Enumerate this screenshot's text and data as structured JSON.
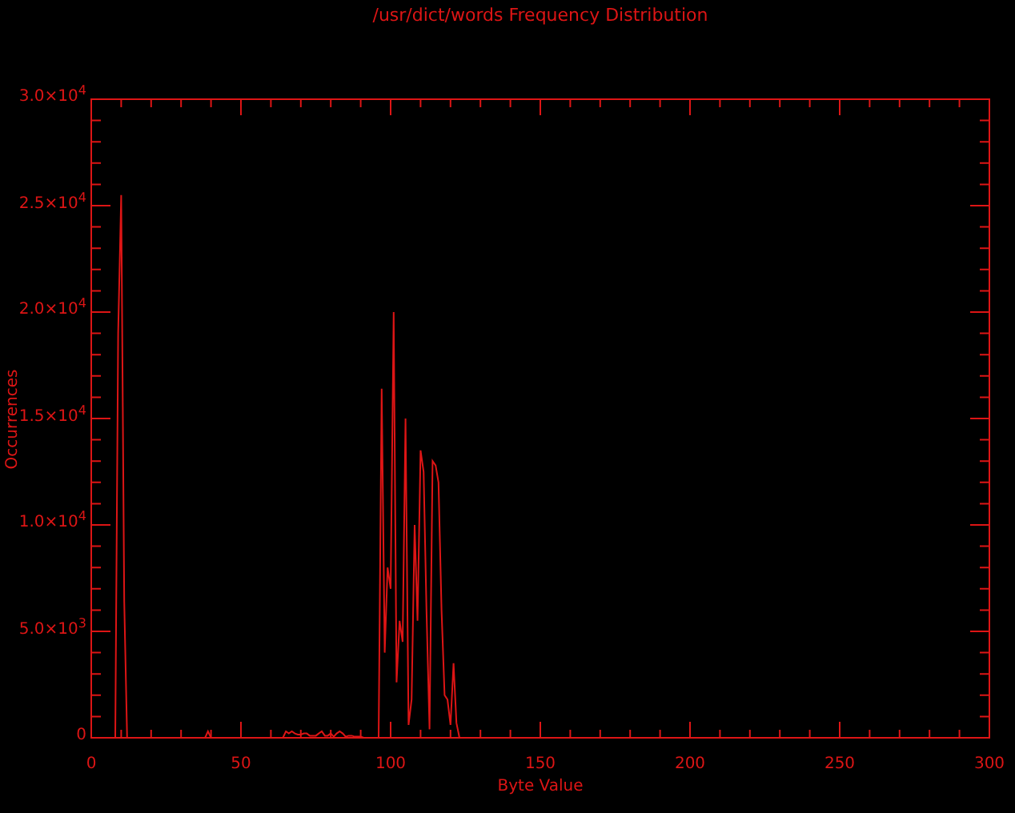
{
  "plot": {
    "chart_data": {
      "type": "line",
      "title": "/usr/dict/words Frequency Distribution",
      "xlabel": "Byte Value",
      "ylabel": "Occurrences",
      "xlim": [
        0,
        300
      ],
      "ylim": [
        0,
        30000
      ],
      "xticks": [
        0,
        50,
        100,
        150,
        200,
        250,
        300
      ],
      "yticks": [
        {
          "value": 0,
          "label": "0"
        },
        {
          "value": 5000,
          "label": "5.0×10$^{3}$"
        },
        {
          "value": 10000,
          "label": "1.0×10$^{4}$"
        },
        {
          "value": 15000,
          "label": "1.5×10$^{4}$"
        },
        {
          "value": 20000,
          "label": "2.0×10$^{4}$"
        },
        {
          "value": 25000,
          "label": "2.5×10$^{4}$"
        },
        {
          "value": 30000,
          "label": "3.0×10$^{4}$"
        }
      ],
      "x": [
        0,
        1,
        2,
        3,
        4,
        5,
        6,
        7,
        8,
        9,
        10,
        11,
        12,
        13,
        14,
        15,
        16,
        17,
        18,
        19,
        20,
        21,
        22,
        23,
        24,
        25,
        26,
        27,
        28,
        29,
        30,
        31,
        32,
        33,
        34,
        35,
        36,
        37,
        38,
        39,
        40,
        41,
        42,
        43,
        44,
        45,
        46,
        47,
        48,
        49,
        50,
        51,
        52,
        53,
        54,
        55,
        56,
        57,
        58,
        59,
        60,
        61,
        62,
        63,
        64,
        65,
        66,
        67,
        68,
        69,
        70,
        71,
        72,
        73,
        74,
        75,
        76,
        77,
        78,
        79,
        80,
        81,
        82,
        83,
        84,
        85,
        86,
        87,
        88,
        89,
        90,
        91,
        92,
        93,
        94,
        95,
        96,
        97,
        98,
        99,
        100,
        101,
        102,
        103,
        104,
        105,
        106,
        107,
        108,
        109,
        110,
        111,
        112,
        113,
        114,
        115,
        116,
        117,
        118,
        119,
        120,
        121,
        122,
        123,
        124,
        125,
        126,
        127
      ],
      "series": [
        {
          "color": "#dd1515",
          "values": [
            0,
            0,
            0,
            0,
            0,
            0,
            0,
            0,
            0,
            19000,
            25500,
            6400,
            0,
            0,
            0,
            0,
            0,
            0,
            0,
            0,
            0,
            0,
            0,
            0,
            0,
            0,
            0,
            0,
            0,
            0,
            0,
            0,
            0,
            0,
            0,
            0,
            0,
            0,
            0,
            300,
            0,
            0,
            0,
            0,
            0,
            0,
            0,
            0,
            0,
            0,
            0,
            0,
            0,
            0,
            0,
            0,
            0,
            0,
            0,
            0,
            0,
            0,
            0,
            0,
            0,
            300,
            200,
            300,
            200,
            150,
            150,
            200,
            200,
            100,
            100,
            100,
            200,
            300,
            100,
            100,
            200,
            50,
            200,
            300,
            200,
            50,
            100,
            100,
            50,
            50,
            50,
            0,
            0,
            0,
            0,
            0,
            0,
            16400,
            4000,
            8000,
            7000,
            20000,
            2600,
            5500,
            4500,
            15000,
            600,
            1800,
            10000,
            5500,
            13500,
            12500,
            6000,
            400,
            13000,
            12800,
            12000,
            6000,
            2000,
            1800,
            600,
            3500,
            700,
            0,
            0,
            0,
            0,
            0
          ]
        }
      ]
    }
  }
}
